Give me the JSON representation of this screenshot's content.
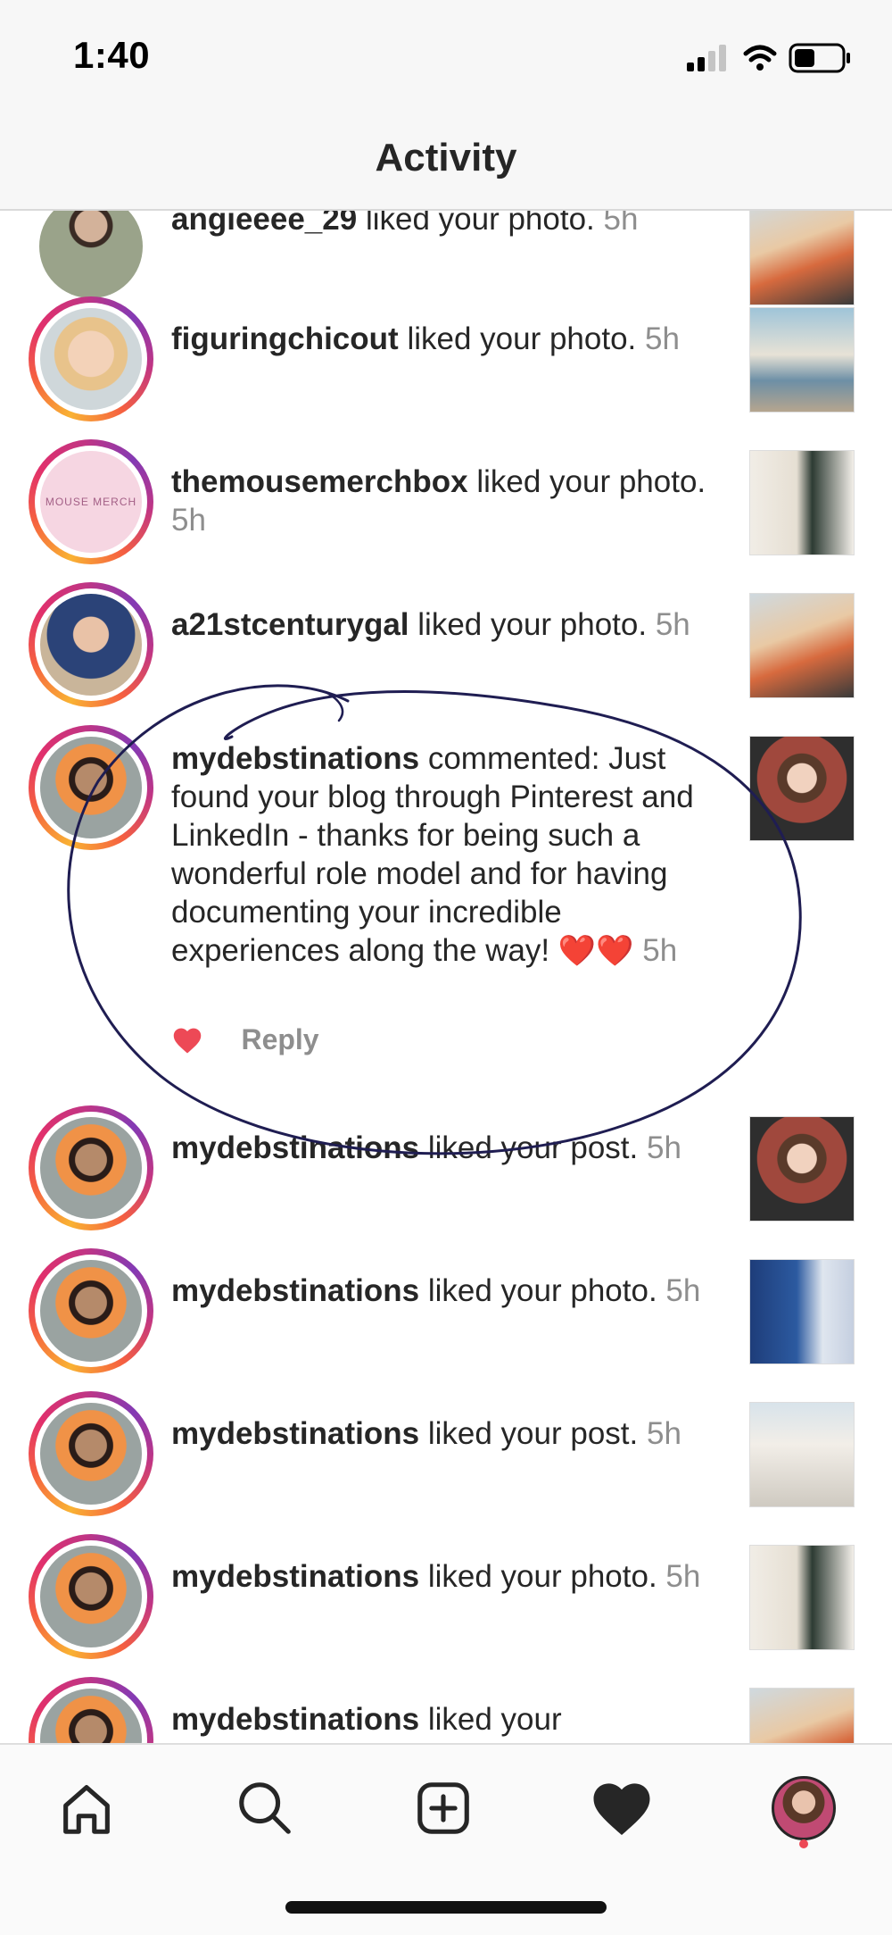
{
  "status_bar": {
    "time": "1:40"
  },
  "header": {
    "title": "Activity"
  },
  "notifications": [
    {
      "user": "angieeee_29",
      "action": "liked your photo.",
      "time": "5h"
    },
    {
      "user": "figuringchicout",
      "action": "liked your photo.",
      "time": "5h"
    },
    {
      "user": "themousemerchbox",
      "action": "liked your photo.",
      "time": "5h",
      "avatar_text": "MOUSE MERCH"
    },
    {
      "user": "a21stcenturygal",
      "action": "liked your photo.",
      "time": "5h"
    },
    {
      "user": "mydebstinations",
      "action": "commented: Just found your blog through Pinterest and LinkedIn - thanks for being such a wonderful role model and for having documenting your incredible experiences along the way!",
      "emoji": "❤️❤️",
      "time": "5h",
      "reply_label": "Reply"
    },
    {
      "user": "mydebstinations",
      "action": "liked your post.",
      "time": "5h"
    },
    {
      "user": "mydebstinations",
      "action": "liked your photo.",
      "time": "5h"
    },
    {
      "user": "mydebstinations",
      "action": "liked your post.",
      "time": "5h"
    },
    {
      "user": "mydebstinations",
      "action": "liked your photo.",
      "time": "5h"
    },
    {
      "user": "mydebstinations",
      "action": "liked your",
      "time": ""
    }
  ],
  "tabbar": {
    "items": [
      "home-icon",
      "search-icon",
      "new-post-icon",
      "activity-heart-icon",
      "profile-avatar"
    ]
  },
  "colors": {
    "accent_red": "#ed4956",
    "secondary_text": "#8e8e8e"
  }
}
